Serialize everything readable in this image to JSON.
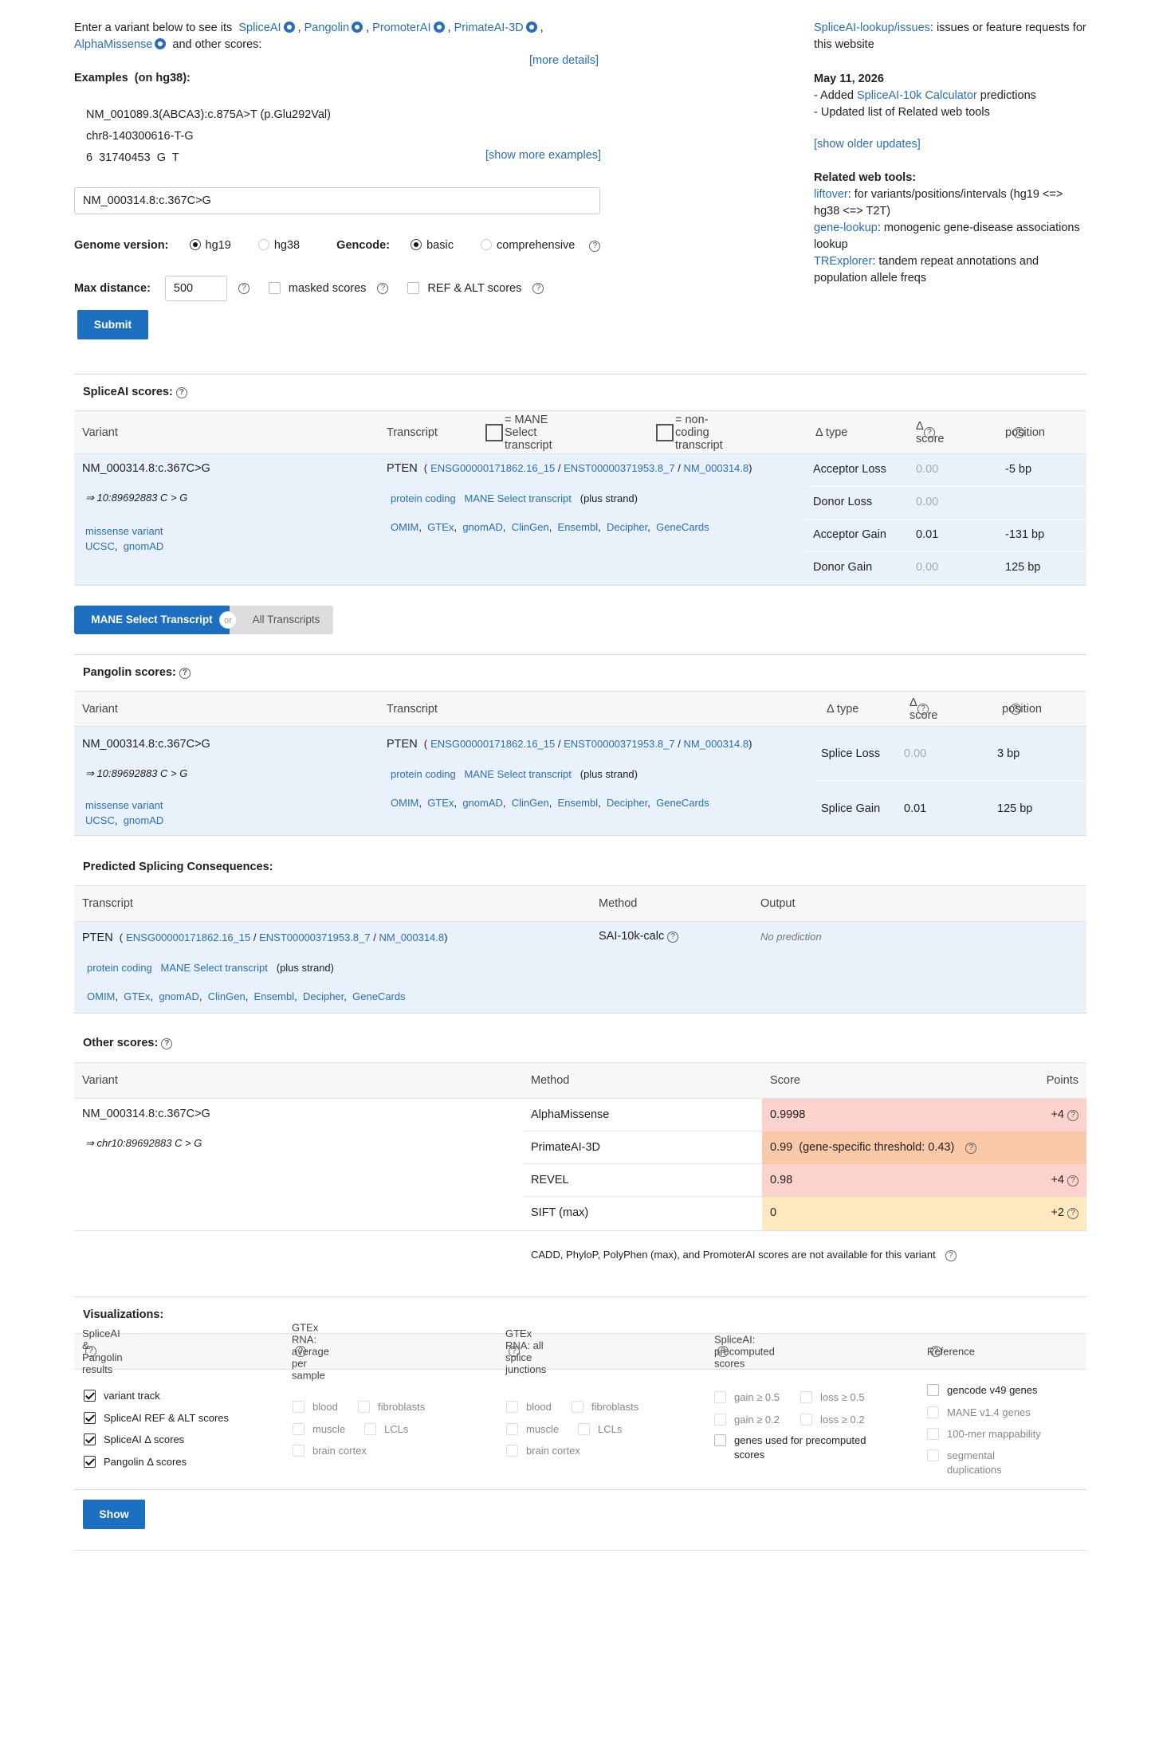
{
  "intro": {
    "lead": "Enter a variant below to see its",
    "tools": [
      "SpliceAI",
      "Pangolin",
      "PromoterAI",
      "PrimateAI-3D",
      "AlphaMissense"
    ],
    "tail": "and other scores:",
    "more_details": "[more details]"
  },
  "examples": {
    "title": "Examples",
    "note": "(on hg38):",
    "items": [
      "NM_001089.3(ABCA3):c.875A>T (p.Glu292Val)",
      "chr8-140300616-T-G",
      "6  31740453  G  T"
    ],
    "show_more": "[show more examples]"
  },
  "form": {
    "variant_value": "NM_000314.8:c.367C>G",
    "genome_label": "Genome version:",
    "genome_opts": [
      "hg19",
      "hg38"
    ],
    "gencode_label": "Gencode:",
    "gencode_opts": [
      "basic",
      "comprehensive"
    ],
    "maxdist_label": "Max distance:",
    "maxdist_value": "500",
    "masked": "masked scores",
    "refalt": "REF & ALT scores",
    "submit": "Submit"
  },
  "sidebar": {
    "issues_link": "SpliceAI-lookup/issues",
    "issues_text": ": issues or feature requests for this website",
    "date": "May 11, 2026",
    "update1_pre": "- Added ",
    "update1_link": "SpliceAI-10k Calculator",
    "update1_post": " predictions",
    "update2": "- Updated list of Related web tools",
    "older": "[show older updates]",
    "related_title": "Related web tools:",
    "tools": [
      {
        "name": "liftover",
        "desc": ": for variants/positions/intervals (hg19 <=> hg38 <=> T2T)"
      },
      {
        "name": "gene-lookup",
        "desc": ": monogenic gene-disease associations lookup"
      },
      {
        "name": "TRExplorer",
        "desc": ": tandem repeat annotations and population allele freqs"
      }
    ]
  },
  "common": {
    "variant": "NM_000314.8:c.367C>G",
    "coord": "⇒ 10:89692883 C > G",
    "coord_chr": "⇒ chr10:89692883 C > G",
    "consequence": "missense variant",
    "ucsc": "UCSC",
    "gnomad": "gnomAD",
    "gene": "PTEN",
    "ensg": "ENSG00000171862.16_15",
    "enst": "ENST00000371953.8_7",
    "nm": "NM_000314.8",
    "biotype": "protein coding",
    "mane": "MANE Select transcript",
    "strand": "(plus strand)",
    "links": [
      "OMIM",
      "GTEx",
      "gnomAD",
      "ClinGen",
      "Ensembl",
      "Decipher",
      "GeneCards"
    ]
  },
  "spliceai": {
    "title": "SpliceAI scores:",
    "col_variant": "Variant",
    "col_transcript": "Transcript",
    "legend_mane": "= MANE Select transcript",
    "legend_nc": "= non-coding transcript",
    "col_type": "Δ type",
    "col_score": "Δ score",
    "col_pos": "position",
    "rows": [
      {
        "type": "Acceptor Loss",
        "score": "0.00",
        "pos": "-5 bp"
      },
      {
        "type": "Donor Loss",
        "score": "0.00",
        "pos": ""
      },
      {
        "type": "Acceptor Gain",
        "score": "0.01",
        "pos": "-131 bp"
      },
      {
        "type": "Donor Gain",
        "score": "0.00",
        "pos": "125 bp"
      }
    ]
  },
  "toggle": {
    "left": "MANE Select Transcript",
    "or": "or",
    "right": "All Transcripts"
  },
  "pangolin": {
    "title": "Pangolin scores:",
    "rows": [
      {
        "type": "Splice Loss",
        "score": "0.00",
        "pos": "3 bp"
      },
      {
        "type": "Splice Gain",
        "score": "0.01",
        "pos": "125 bp"
      }
    ]
  },
  "consequences": {
    "title": "Predicted Splicing Consequences:",
    "col_transcript": "Transcript",
    "col_method": "Method",
    "col_output": "Output",
    "method": "SAI-10k-calc",
    "output": "No prediction"
  },
  "other": {
    "title": "Other scores:",
    "col_variant": "Variant",
    "col_method": "Method",
    "col_score": "Score",
    "col_points": "Points",
    "rows": [
      {
        "method": "AlphaMissense",
        "score": "0.9998",
        "points": "+4",
        "color": "#fbd3cc"
      },
      {
        "method": "PrimateAI-3D",
        "score": "0.99  (gene-specific threshold: 0.43)",
        "points": "",
        "color": "#f9c9a8"
      },
      {
        "method": "REVEL",
        "score": "0.98",
        "points": "+4",
        "color": "#fbd3cc"
      },
      {
        "method": "SIFT (max)",
        "score": "0",
        "points": "+2",
        "color": "#fde8c0"
      }
    ],
    "note": "CADD,  PhyloP,  PolyPhen (max),  and PromoterAI scores are not available for this variant"
  },
  "viz": {
    "title": "Visualizations:",
    "cols": [
      {
        "head": "SpliceAI & Pangolin results"
      },
      {
        "head": "GTEx RNA: average per sample"
      },
      {
        "head": "GTEx RNA: all splice junctions"
      },
      {
        "head": "SpliceAI: precomputed scores"
      },
      {
        "head": "Reference"
      }
    ],
    "sp_items": [
      "variant track",
      "SpliceAI REF & ALT scores",
      "SpliceAI Δ  scores",
      "Pangolin Δ  scores"
    ],
    "gtex_items": [
      "blood",
      "fibroblasts",
      "muscle",
      "LCLs",
      "brain cortex"
    ],
    "pre_items": [
      "gain ≥ 0.5",
      "loss ≥ 0.5",
      "gain ≥ 0.2",
      "loss ≥ 0.2",
      "genes used for precomputed scores"
    ],
    "ref_items": [
      "gencode v49 genes",
      "MANE v1.4 genes",
      "100-mer mappability",
      "segmental duplications"
    ],
    "show": "Show"
  }
}
